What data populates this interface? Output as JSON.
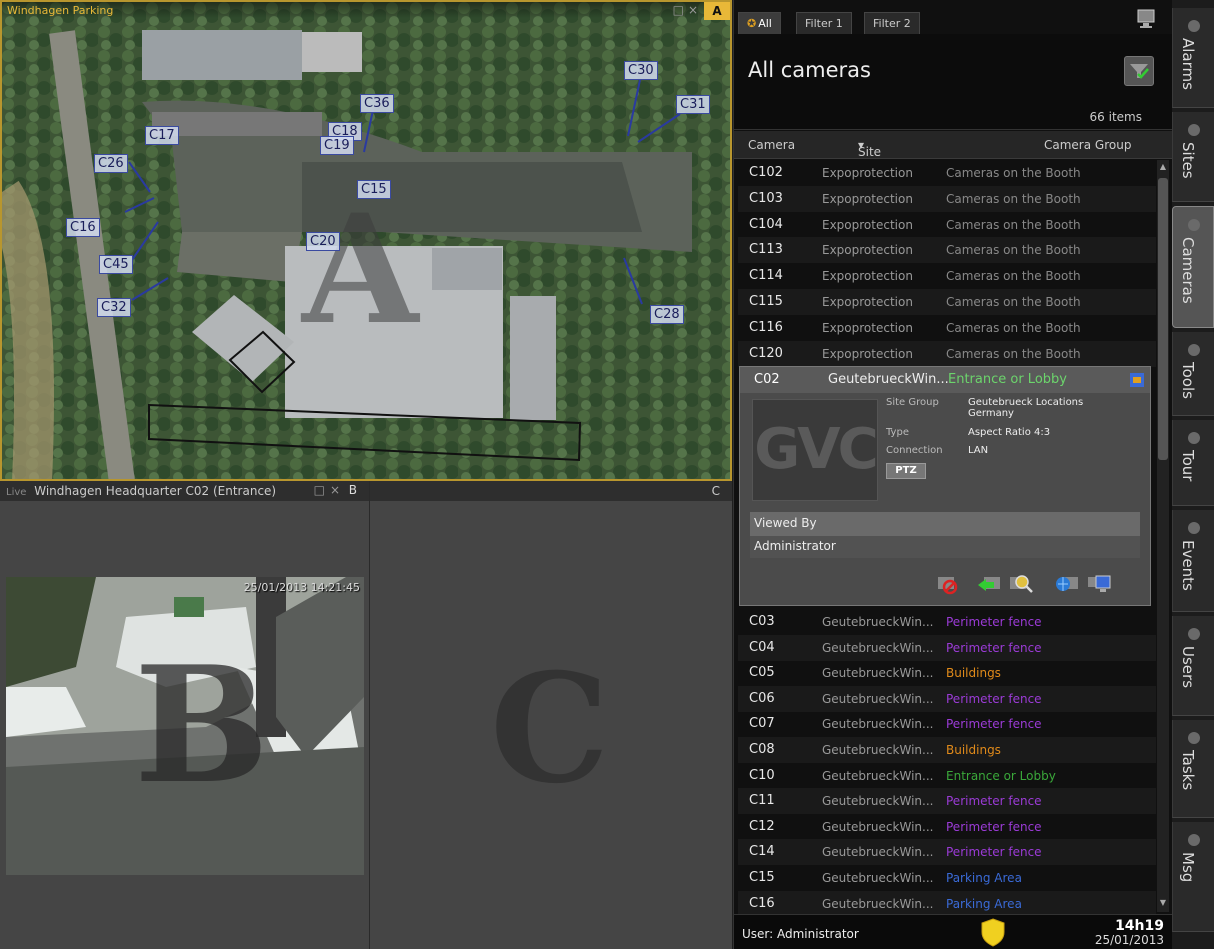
{
  "paneA": {
    "title": "Windhagen Parking",
    "letter": "A",
    "cameras": [
      "C30",
      "C31",
      "C36",
      "C18",
      "C19",
      "C17",
      "C26",
      "C15",
      "C16",
      "C20",
      "C45",
      "C32",
      "C28"
    ]
  },
  "paneB": {
    "live": "Live",
    "title": "Windhagen Headquarter C02 (Entrance)",
    "letter": "B",
    "timestamp": "25/01/2013 14:21:45"
  },
  "paneC": {
    "letter": "C"
  },
  "panel": {
    "tabs": [
      "All",
      "Filter 1",
      "Filter 2"
    ],
    "title": "All cameras",
    "count": "66 items",
    "columns": {
      "camera": "Camera",
      "site": "Site",
      "group": "Camera Group"
    },
    "rows_top": [
      {
        "cam": "C102",
        "site": "Expoprotection",
        "grp": "Cameras on the Booth"
      },
      {
        "cam": "C103",
        "site": "Expoprotection",
        "grp": "Cameras on the Booth"
      },
      {
        "cam": "C104",
        "site": "Expoprotection",
        "grp": "Cameras on the Booth"
      },
      {
        "cam": "C113",
        "site": "Expoprotection",
        "grp": "Cameras on the Booth"
      },
      {
        "cam": "C114",
        "site": "Expoprotection",
        "grp": "Cameras on the Booth"
      },
      {
        "cam": "C115",
        "site": "Expoprotection",
        "grp": "Cameras on the Booth"
      },
      {
        "cam": "C116",
        "site": "Expoprotection",
        "grp": "Cameras on the Booth"
      },
      {
        "cam": "C120",
        "site": "Expoprotection",
        "grp": "Cameras on the Booth"
      }
    ],
    "expanded": {
      "cam": "C02",
      "site": "GeutebrueckWin...",
      "grp": "Entrance or Lobby",
      "thumb": "GVC",
      "site_group_label": "Site Group",
      "site_group_value": "Geutebrueck Locations Germany",
      "type_label": "Type",
      "type_value": "Aspect Ratio 4:3",
      "connection_label": "Connection",
      "connection_value": "LAN",
      "ptz": "PTZ",
      "viewed_by": "Viewed By",
      "viewer": "Administrator"
    },
    "rows_bottom": [
      {
        "cam": "C03",
        "site": "GeutebrueckWin...",
        "grp": "Perimeter fence",
        "color": "#9b3bd6"
      },
      {
        "cam": "C04",
        "site": "GeutebrueckWin...",
        "grp": "Perimeter fence",
        "color": "#9b3bd6"
      },
      {
        "cam": "C05",
        "site": "GeutebrueckWin...",
        "grp": "Buildings",
        "color": "#e08a1a"
      },
      {
        "cam": "C06",
        "site": "GeutebrueckWin...",
        "grp": "Perimeter fence",
        "color": "#9b3bd6"
      },
      {
        "cam": "C07",
        "site": "GeutebrueckWin...",
        "grp": "Perimeter fence",
        "color": "#9b3bd6"
      },
      {
        "cam": "C08",
        "site": "GeutebrueckWin...",
        "grp": "Buildings",
        "color": "#e08a1a"
      },
      {
        "cam": "C10",
        "site": "GeutebrueckWin...",
        "grp": "Entrance or Lobby",
        "color": "#3aa83a"
      },
      {
        "cam": "C11",
        "site": "GeutebrueckWin...",
        "grp": "Perimeter fence",
        "color": "#9b3bd6"
      },
      {
        "cam": "C12",
        "site": "GeutebrueckWin...",
        "grp": "Perimeter fence",
        "color": "#9b3bd6"
      },
      {
        "cam": "C14",
        "site": "GeutebrueckWin...",
        "grp": "Perimeter fence",
        "color": "#9b3bd6"
      },
      {
        "cam": "C15",
        "site": "GeutebrueckWin...",
        "grp": "Parking Area",
        "color": "#3a6ad6"
      },
      {
        "cam": "C16",
        "site": "GeutebrueckWin...",
        "grp": "Parking Area",
        "color": "#3a6ad6"
      }
    ],
    "status_user": "User: Administrator",
    "clock_time": "14h19",
    "clock_date": "25/01/2013"
  },
  "sidenav": [
    "Alarms",
    "Sites",
    "Cameras",
    "Tools",
    "Tour",
    "Events",
    "Users",
    "Tasks",
    "Msg"
  ]
}
